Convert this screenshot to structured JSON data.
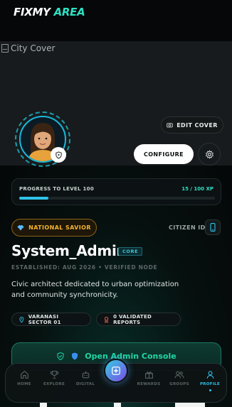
{
  "header": {
    "logo_part1": "FIXMY",
    "logo_part2": "AREA"
  },
  "cover": {
    "alt_text": "City Cover",
    "edit_label": "EDIT COVER"
  },
  "profile": {
    "configure_label": "CONFIGURE",
    "progress": {
      "label": "PROGRESS TO LEVEL 100",
      "xp": "15 / 100 XP",
      "fraction": 0.15
    },
    "rank_badge": "NATIONAL SAVIOR",
    "citizen_id_label": "CITIZEN ID",
    "username": "System_Admin",
    "role_badge": "CORE",
    "established": "ESTABLISHED: AUG 2026 • VERIFIED NODE",
    "bio": "Civic architect dedicated to urban optimization and community synchronicity.",
    "location": "VARANASI SECTOR 01",
    "reports": "0 VALIDATED REPORTS",
    "admin_button": "Open Admin Console"
  },
  "nav": {
    "items": [
      {
        "label": "HOME",
        "icon": "home-icon"
      },
      {
        "label": "EXPLORE",
        "icon": "trophy-icon"
      },
      {
        "label": "DIGITAL",
        "icon": "bot-icon"
      },
      {
        "label": "REWARDS",
        "icon": "gift-icon"
      },
      {
        "label": "GROUPS",
        "icon": "users-icon"
      },
      {
        "label": "PROFILE",
        "icon": "user-icon",
        "active": true
      }
    ],
    "fab_icon": "plus-square-icon"
  },
  "colors": {
    "accent": "#2de0c4",
    "cyan": "#2fc3e8",
    "gold": "#f4b52e",
    "admin_green": "#22d6a5"
  }
}
